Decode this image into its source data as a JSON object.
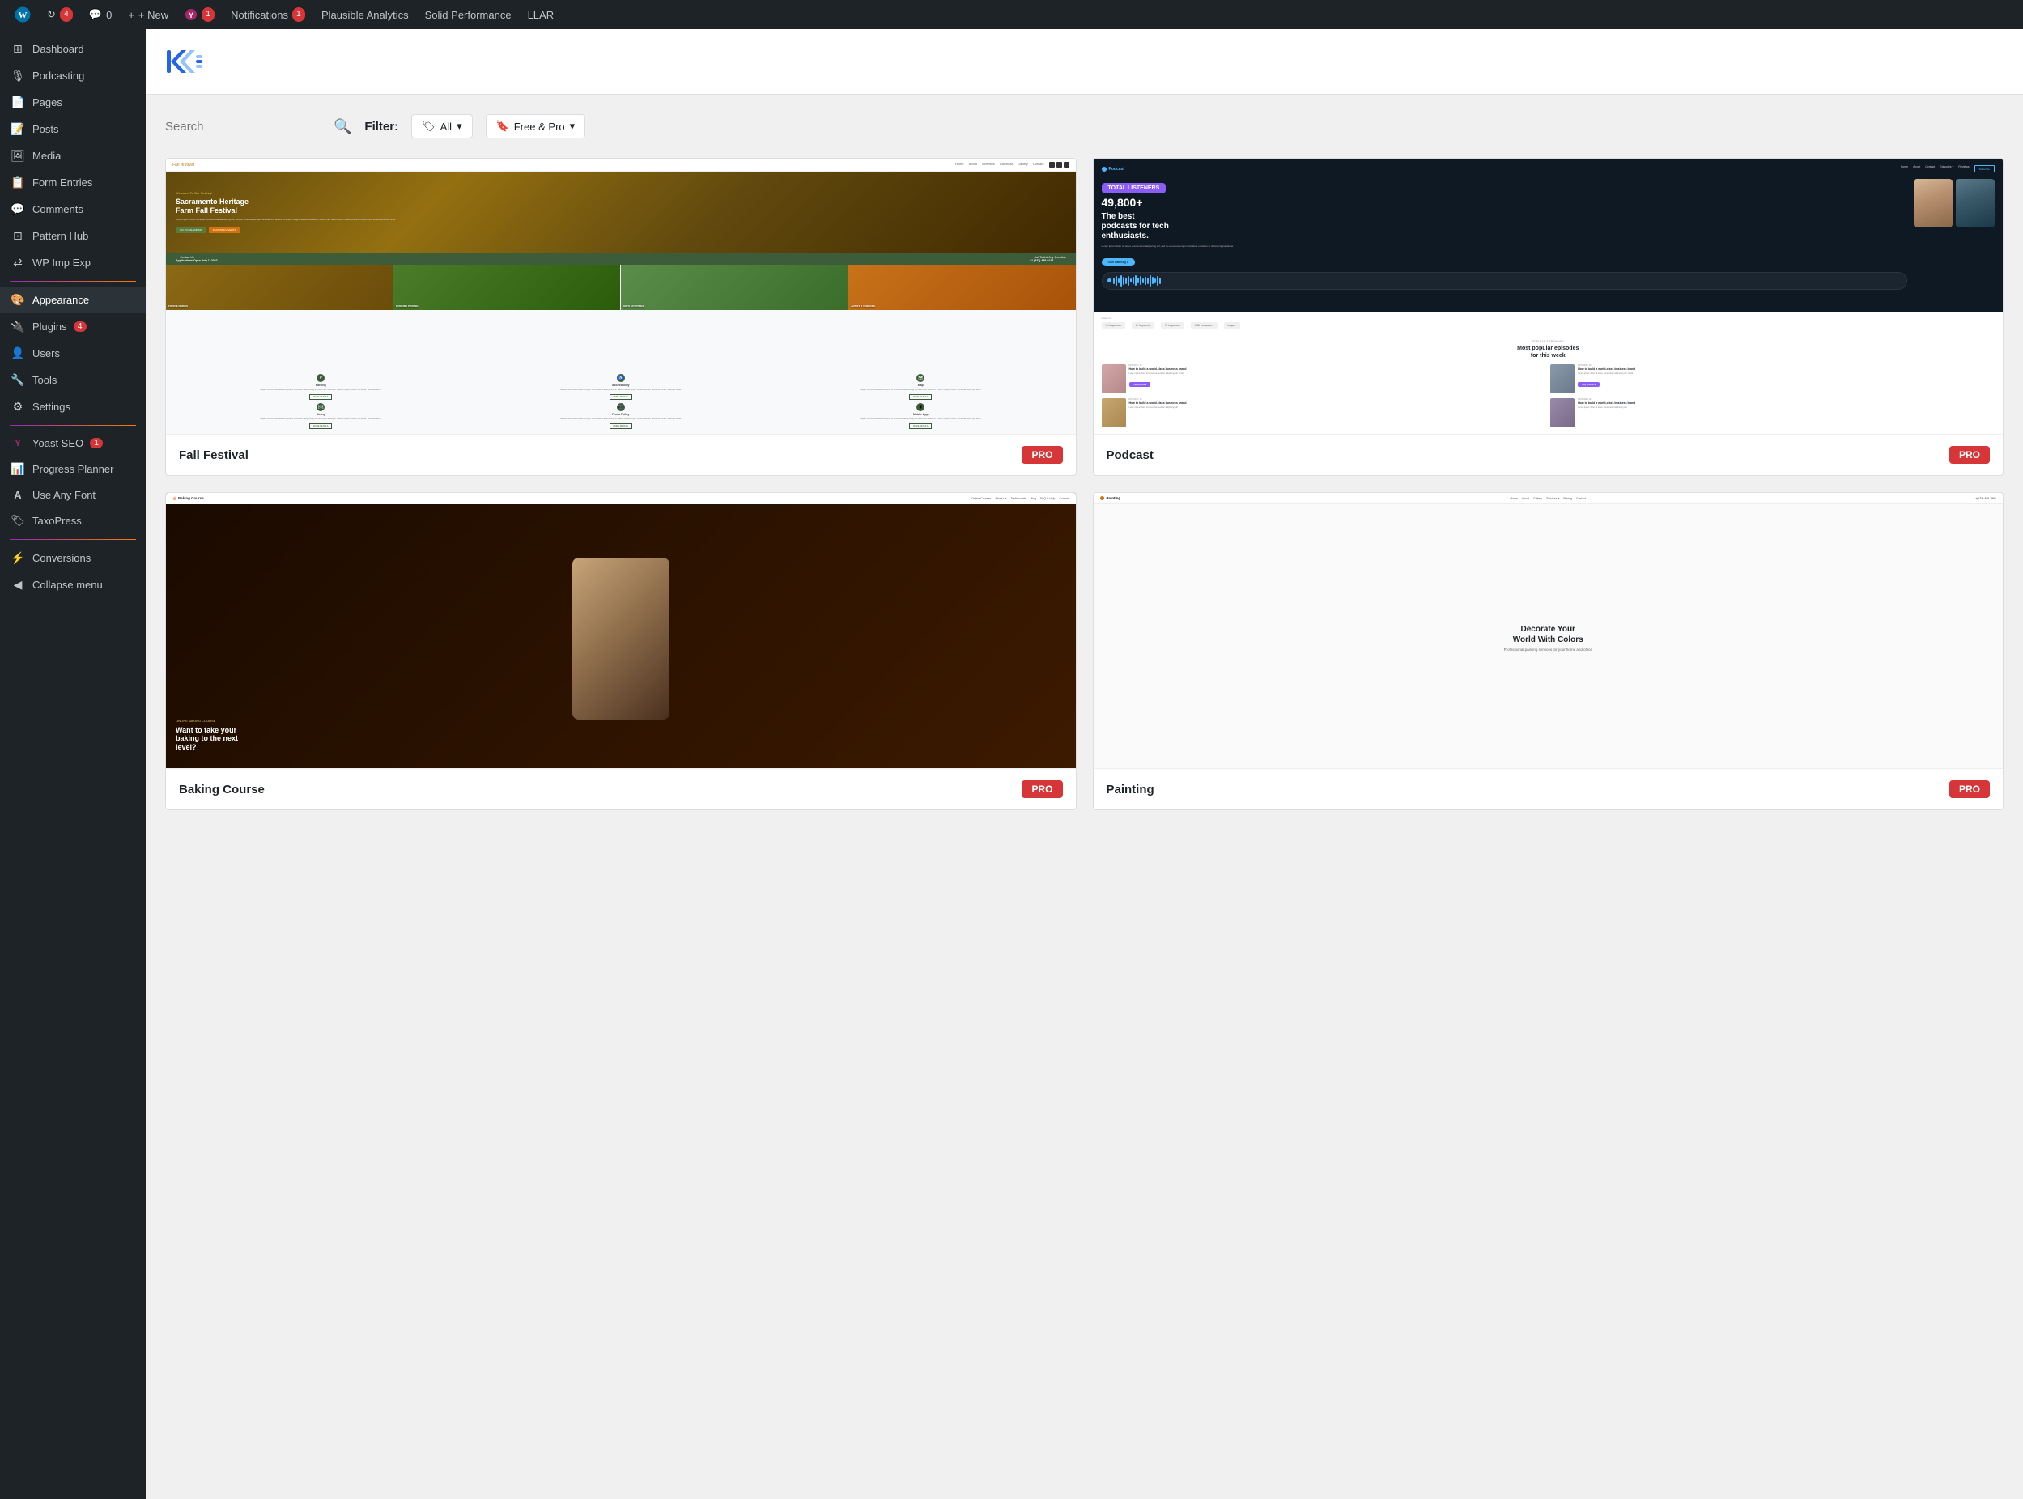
{
  "adminbar": {
    "items": [
      {
        "id": "wp-logo",
        "label": "W",
        "type": "logo"
      },
      {
        "id": "updates",
        "label": "4",
        "icon": "↻",
        "badge": "4"
      },
      {
        "id": "comments",
        "label": "0",
        "icon": "💬",
        "badge": "0"
      },
      {
        "id": "new",
        "label": "+ New"
      },
      {
        "id": "yoast",
        "label": "Y",
        "badge": "1"
      },
      {
        "id": "notifications",
        "label": "Notifications",
        "badge": "1"
      },
      {
        "id": "plausible",
        "label": "Plausible Analytics"
      },
      {
        "id": "solid",
        "label": "Solid Performance"
      },
      {
        "id": "llar",
        "label": "LLAR"
      }
    ]
  },
  "sidebar": {
    "items": [
      {
        "id": "dashboard",
        "label": "Dashboard",
        "icon": "⊞"
      },
      {
        "id": "podcasting",
        "label": "Podcasting",
        "icon": "🎙"
      },
      {
        "id": "pages",
        "label": "Pages",
        "icon": "📄"
      },
      {
        "id": "posts",
        "label": "Posts",
        "icon": "📝"
      },
      {
        "id": "media",
        "label": "Media",
        "icon": "🖼"
      },
      {
        "id": "form-entries",
        "label": "Form Entries",
        "icon": "📋"
      },
      {
        "id": "comments",
        "label": "Comments",
        "icon": "💬"
      },
      {
        "id": "pattern-hub",
        "label": "Pattern Hub",
        "icon": "⊡"
      },
      {
        "id": "wp-imp-exp",
        "label": "WP Imp Exp",
        "icon": "⇄"
      },
      {
        "id": "appearance",
        "label": "Appearance",
        "icon": "🎨",
        "active": true
      },
      {
        "id": "plugins",
        "label": "Plugins",
        "icon": "🔌",
        "badge": "4"
      },
      {
        "id": "users",
        "label": "Users",
        "icon": "👤"
      },
      {
        "id": "tools",
        "label": "Tools",
        "icon": "🔧"
      },
      {
        "id": "settings",
        "label": "Settings",
        "icon": "⚙"
      },
      {
        "id": "yoast-seo",
        "label": "Yoast SEO",
        "icon": "Y",
        "badge": "1"
      },
      {
        "id": "progress-planner",
        "label": "Progress Planner",
        "icon": "📊"
      },
      {
        "id": "use-any-font",
        "label": "Use Any Font",
        "icon": "A"
      },
      {
        "id": "taxopress",
        "label": "TaxoPress",
        "icon": "🏷"
      },
      {
        "id": "conversions",
        "label": "Conversions",
        "icon": "⚡"
      },
      {
        "id": "collapse-menu",
        "label": "Collapse menu",
        "icon": "◀"
      }
    ]
  },
  "header": {
    "logo_text": "≡ →"
  },
  "filter_bar": {
    "search_placeholder": "Search",
    "filter_label": "Filter:",
    "all_label": "All",
    "free_pro_label": "Free & Pro"
  },
  "themes": [
    {
      "id": "fall-festival",
      "name": "Fall Festival",
      "badge": "PRO",
      "type": "fall-festival"
    },
    {
      "id": "podcast",
      "name": "Podcast",
      "badge": "PRO",
      "type": "podcast"
    },
    {
      "id": "baking-course",
      "name": "Baking Course",
      "badge": "PRO",
      "type": "baking"
    },
    {
      "id": "painting",
      "name": "Painting",
      "badge": "PRO",
      "type": "painting"
    }
  ]
}
